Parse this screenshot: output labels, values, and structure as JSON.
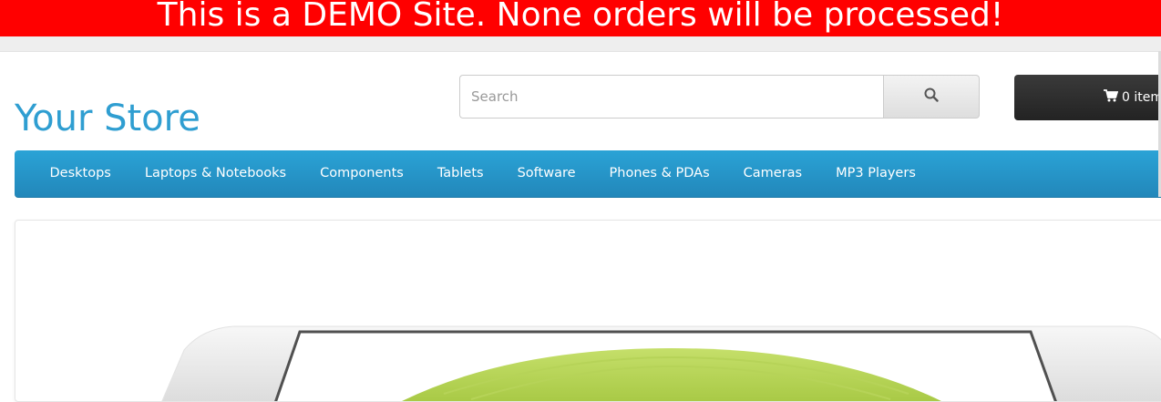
{
  "banner": {
    "text": "This is a DEMO Site. None orders will be processed!"
  },
  "header": {
    "logo": "Your Store",
    "search": {
      "placeholder": "Search",
      "value": ""
    },
    "cart": {
      "label": "0 item"
    }
  },
  "menu": {
    "items": [
      "Desktops",
      "Laptops & Notebooks",
      "Components",
      "Tablets",
      "Software",
      "Phones & PDAs",
      "Cameras",
      "MP3 Players"
    ]
  },
  "colors": {
    "banner": "#ff0000",
    "logo": "#2f9ed1",
    "menu": "#229ac8",
    "cart": "#2f2f2f"
  },
  "icons": {
    "search": "search-icon",
    "cart": "shopping-cart-icon"
  }
}
